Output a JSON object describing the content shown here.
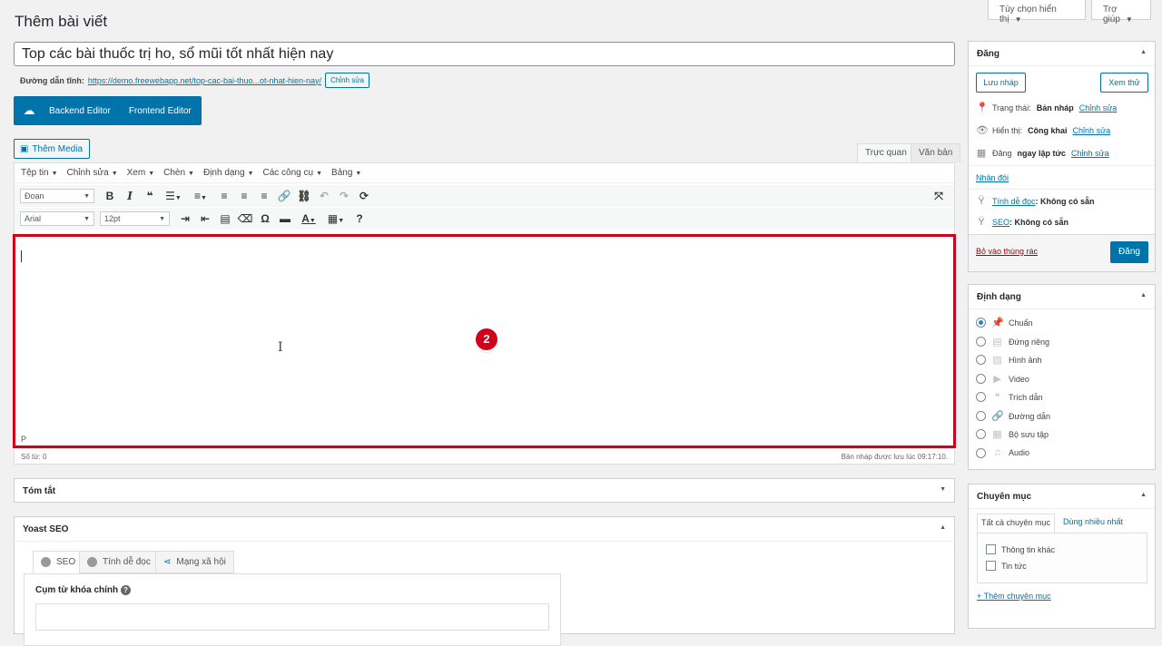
{
  "header": {
    "screen_options": "Tùy chọn hiển thị",
    "help": "Trợ giúp",
    "page_title": "Thêm bài viết"
  },
  "post": {
    "title": "Top các bài thuốc trị ho, sổ mũi tốt nhất hiện nay",
    "permalink_label": "Đường dẫn tĩnh:",
    "permalink_url": "https://demo.freewebapp.net/top-cac-bai-thuo...ot-nhat-hien-nay/",
    "permalink_edit": "Chỉnh sửa"
  },
  "editor_switch": {
    "backend": "Backend Editor",
    "frontend": "Frontend Editor"
  },
  "editor": {
    "add_media": "Thêm Media",
    "tab_visual": "Trực quan",
    "tab_text": "Văn bản",
    "menus": [
      "Tệp tin",
      "Chỉnh sửa",
      "Xem",
      "Chèn",
      "Định dạng",
      "Các công cụ",
      "Bảng"
    ],
    "format_select": "Đoạn",
    "font_select": "Arial",
    "size_select": "12pt",
    "badge": "2",
    "path": "P",
    "word_count": "Số từ: 0",
    "draft_saved": "Bản nháp được lưu lúc 09:17:10."
  },
  "metaboxes": {
    "excerpt": "Tóm tắt",
    "yoast": "Yoast SEO",
    "yoast_tabs": [
      "SEO",
      "Tính dễ đọc",
      "Mạng xã hội"
    ],
    "focus_keyphrase": "Cụm từ khóa chính"
  },
  "publish": {
    "title": "Đăng",
    "save_draft": "Lưu nháp",
    "preview": "Xem thử",
    "status_label": "Trạng thái:",
    "status_value": "Bản nháp",
    "visibility_label": "Hiển thị:",
    "visibility_value": "Công khai",
    "schedule_label": "Đăng",
    "schedule_value": "ngay lập tức",
    "edit": "Chỉnh sửa",
    "duplicate": "Nhân đôi",
    "readability_link": "Tính dễ đọc",
    "readability_value": ": Không có sẵn",
    "seo_link": "SEO",
    "seo_value": ": Không có sẵn",
    "trash": "Bỏ vào thùng rác",
    "publish_btn": "Đăng"
  },
  "format": {
    "title": "Định dạng",
    "options": [
      "Chuẩn",
      "Đứng riêng",
      "Hình ảnh",
      "Video",
      "Trích dẫn",
      "Đường dẫn",
      "Bộ sưu tập",
      "Audio"
    ]
  },
  "categories": {
    "title": "Chuyên mục",
    "tab_all": "Tất cả chuyên mục",
    "tab_popular": "Dùng nhiều nhất",
    "items": [
      "Thông tin khác",
      "Tin tức"
    ],
    "add_new": "+ Thêm chuyên mục"
  },
  "colors": {
    "accent": "#0073aa",
    "highlight": "#d0021b"
  }
}
